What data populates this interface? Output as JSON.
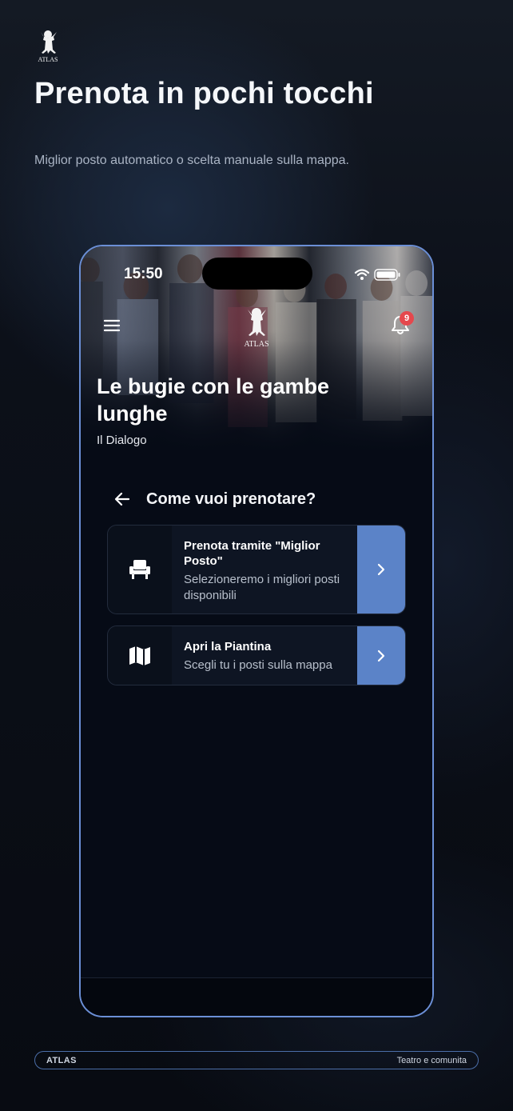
{
  "header": {
    "logo_text": "ATLAS",
    "title": "Prenota in pochi tocchi",
    "subtitle": "Miglior posto automatico o scelta manuale sulla mappa."
  },
  "phone": {
    "status_time": "15:50",
    "logo_text": "ATLAS",
    "notification_count": "9",
    "show_title": "Le bugie con le gambe lunghe",
    "show_company": "Il Dialogo",
    "question": "Come vuoi prenotare?",
    "options": [
      {
        "title": "Prenota tramite \"Miglior Posto\"",
        "description": "Selezioneremo i migliori posti disponibili",
        "icon": "seat-icon"
      },
      {
        "title": "Apri la Piantina",
        "description": "Scegli tu i posti sulla mappa",
        "icon": "map-icon"
      }
    ]
  },
  "footer": {
    "brand": "ATLAS",
    "tagline": "Teatro e comunita"
  },
  "colors": {
    "accent": "#5b83c8",
    "frame": "#6b8fd6",
    "badge": "#e5484d"
  }
}
